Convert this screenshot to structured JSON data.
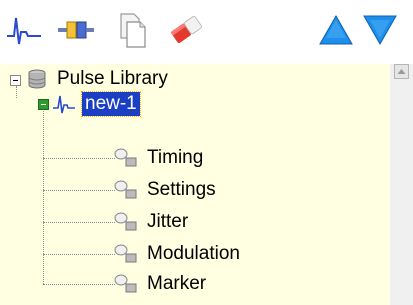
{
  "toolbar": {
    "buttons": [
      {
        "name": "pulse-waveform-icon"
      },
      {
        "name": "connector-icon"
      },
      {
        "name": "copy-icon"
      },
      {
        "name": "eraser-icon"
      },
      {
        "name": "move-up-icon"
      },
      {
        "name": "move-down-icon"
      }
    ]
  },
  "tree": {
    "root": {
      "label": "Pulse Library",
      "icon": "database-icon",
      "expanded": true
    },
    "pulse": {
      "label": "new-1",
      "icon": "pulse-waveform-icon",
      "selected": true,
      "expanded": true
    },
    "children": [
      {
        "label": "Timing",
        "icon": "properties-node-icon"
      },
      {
        "label": "Settings",
        "icon": "properties-node-icon"
      },
      {
        "label": "Jitter",
        "icon": "properties-node-icon"
      },
      {
        "label": "Modulation",
        "icon": "properties-node-icon"
      },
      {
        "label": "Marker",
        "icon": "properties-node-icon"
      }
    ]
  },
  "colors": {
    "tree_background": "#ffffe1",
    "selection": "#1a3fc2",
    "pulse_icon": "#2a4bd0",
    "arrows": "#1e8fe8"
  }
}
